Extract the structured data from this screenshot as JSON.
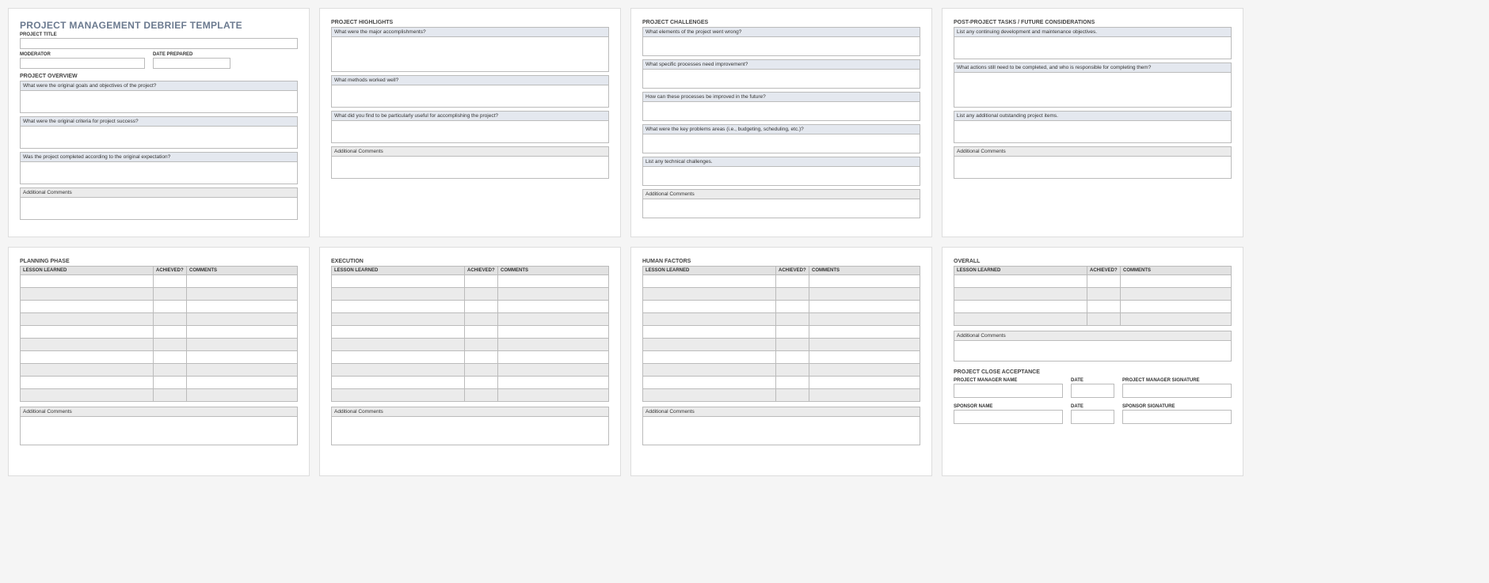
{
  "page1": {
    "title": "PROJECT MANAGEMENT DEBRIEF TEMPLATE",
    "project_title_label": "PROJECT TITLE",
    "moderator_label": "MODERATOR",
    "date_prepared_label": "DATE PREPARED",
    "overview_heading": "PROJECT OVERVIEW",
    "q1": "What were the original goals and objectives of the project?",
    "q2": "What were the original criteria for project success?",
    "q3": "Was the project completed according to the original expectation?",
    "additional": "Additional Comments"
  },
  "page2": {
    "heading": "PROJECT HIGHLIGHTS",
    "q1": "What were the major accomplishments?",
    "q2": "What methods worked well?",
    "q3": "What did you find to be particularly useful for accomplishing the project?",
    "additional": "Additional Comments"
  },
  "page3": {
    "heading": "PROJECT CHALLENGES",
    "q1": "What elements of the project went wrong?",
    "q2": "What specific processes need improvement?",
    "q3": "How can these processes be improved in the future?",
    "q4": "What were the key problems areas (i.e., budgeting, scheduling, etc.)?",
    "q5": "List any technical challenges.",
    "additional": "Additional Comments"
  },
  "page4": {
    "heading": "POST-PROJECT TASKS / FUTURE CONSIDERATIONS",
    "q1": "List any continuing development and maintenance objectives.",
    "q2": "What actions still need to be completed, and who is responsible for completing them?",
    "q3": "List any additional outstanding project items.",
    "additional": "Additional Comments"
  },
  "lessons_headers": {
    "lesson": "LESSON LEARNED",
    "achieved": "ACHIEVED?",
    "comments": "COMMENTS"
  },
  "page5": {
    "heading": "PLANNING PHASE",
    "additional": "Additional Comments",
    "row_count": 10
  },
  "page6": {
    "heading": "EXECUTION",
    "additional": "Additional Comments",
    "row_count": 10
  },
  "page7": {
    "heading": "HUMAN FACTORS",
    "additional": "Additional Comments",
    "row_count": 10
  },
  "page8": {
    "overall_heading": "OVERALL",
    "additional": "Additional Comments",
    "row_count": 4,
    "close_heading": "PROJECT CLOSE ACCEPTANCE",
    "pm_name": "PROJECT MANAGER NAME",
    "date": "DATE",
    "pm_sig": "PROJECT MANAGER SIGNATURE",
    "sponsor_name": "SPONSOR NAME",
    "sponsor_sig": "SPONSOR SIGNATURE"
  }
}
